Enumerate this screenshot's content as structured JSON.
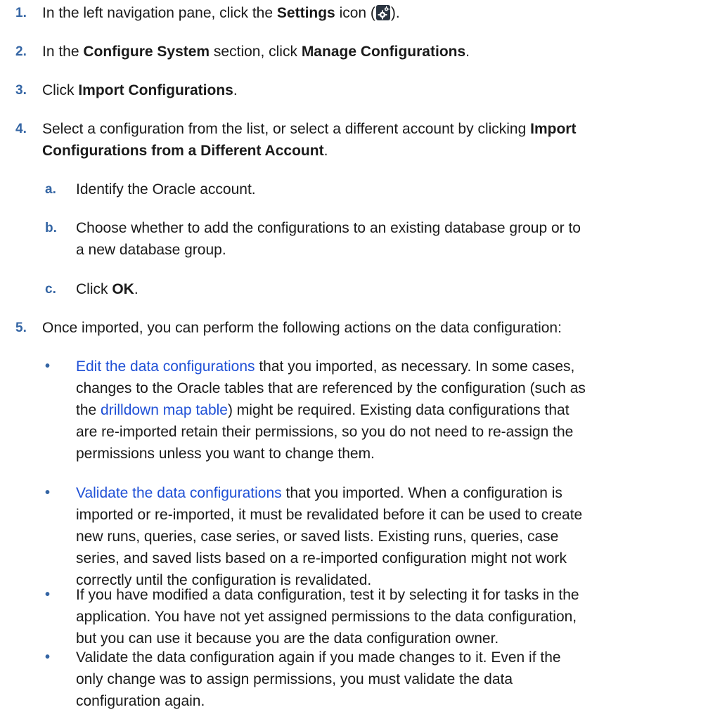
{
  "steps": [
    {
      "num": "1.",
      "pre": "In the left navigation pane, click the ",
      "bold": "Settings",
      "mid": " icon (",
      "post": ")."
    },
    {
      "num": "2.",
      "pre": "In the ",
      "bold1": "Configure System",
      "mid": " section, click ",
      "bold2": "Manage Configurations",
      "post": "."
    },
    {
      "num": "3.",
      "pre": "Click ",
      "bold": "Import Configurations",
      "post": "."
    },
    {
      "num": "4.",
      "line1_pre": "Select a configuration from the list, or select a different account by clicking ",
      "line1_bold": "Import",
      "line2_bold": "Configurations from a Different Account",
      "post": "."
    },
    {
      "num": "5.",
      "text": "Once imported, you can perform the following actions on the data configuration:"
    }
  ],
  "substeps": [
    {
      "letter": "a.",
      "text": "Identify the Oracle account."
    },
    {
      "letter": "b.",
      "line1": "Choose whether to add the configurations to an existing database group or to",
      "line2": "a new database group."
    },
    {
      "letter": "c.",
      "pre": "Click ",
      "bold": "OK",
      "post": "."
    }
  ],
  "bullets": [
    {
      "marker": "•",
      "link1": "Edit the data configurations",
      "l1_rest": " that you imported, as necessary. In some cases,",
      "l2": "changes to the Oracle tables that are referenced by the configuration (such as",
      "l3_pre": "the ",
      "link2": "drilldown map table",
      "l3_rest": ") might be required. Existing data configurations that",
      "l4": "are re-imported retain their permissions, so you do not need to re-assign the",
      "l5": "permissions unless you want to change them."
    },
    {
      "marker": "•",
      "link1": "Validate the data configurations",
      "l1_rest": " that you imported. When a configuration is",
      "l2": "imported or re-imported, it must be revalidated before it can be used to create",
      "l3": "new runs, queries, case series, or saved lists. Existing runs, queries, case",
      "l4": "series, and saved lists based on a re-imported configuration might not work",
      "l5": "correctly until the configuration is revalidated."
    },
    {
      "marker": "•",
      "l1": "If you have modified a data configuration, test it by selecting it for tasks in the",
      "l2": "application. You have not yet assigned permissions to the data configuration,",
      "l3": "but you can use it because you are the data configuration owner."
    },
    {
      "marker": "•",
      "l1": "Validate the data configuration again if you made changes to it. Even if the",
      "l2": "only change was to assign permissions, you must validate the data",
      "l3": "configuration again."
    }
  ],
  "colors": {
    "number_blue": "#3465a4",
    "link_blue": "#1f50d6",
    "icon_bg": "#2b3440"
  },
  "icons": {
    "settings": "gear-icon"
  }
}
